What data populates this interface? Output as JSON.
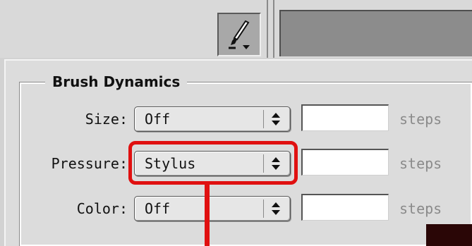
{
  "toolbar": {
    "brush_icon": "brush-icon"
  },
  "brush_dynamics": {
    "title": "Brush Dynamics",
    "rows": [
      {
        "label": "Size:",
        "value": "Off",
        "field": "",
        "unit": "steps"
      },
      {
        "label": "Pressure:",
        "value": "Stylus",
        "field": "",
        "unit": "steps"
      },
      {
        "label": "Color:",
        "value": "Off",
        "field": "",
        "unit": "steps"
      }
    ]
  },
  "annotation": {
    "highlight_color": "#e01010"
  }
}
